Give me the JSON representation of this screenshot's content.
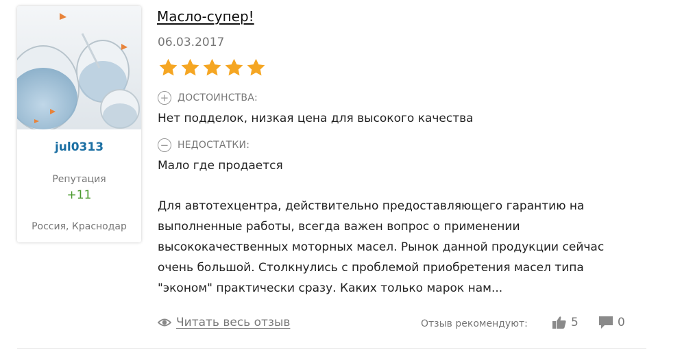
{
  "user": {
    "username": "jul0313",
    "reputation_label": "Репутация",
    "reputation_value": "+11",
    "location": "Россия, Краснодар"
  },
  "review": {
    "title": "Масло-супер!",
    "date": "06.03.2017",
    "rating": 5,
    "rating_max": 5,
    "pros_label": "ДОСТОИНСТВА:",
    "pros_text": "Нет подделок, низкая цена для высокого качества",
    "cons_label": "НЕДОСТАТКИ:",
    "cons_text": "Мало где продается",
    "body_lines": [
      "Для автотехцентра, действительно предоставляющего гарантию на",
      "выполненные работы, всегда важен вопрос о применении",
      "высококачественных моторных масел. Рынок данной продукции сейчас",
      "очень большой. Столкнулись с проблемой приобретения масел типа",
      "\"эконом\" практически сразу. Каких только марок нам..."
    ]
  },
  "footer": {
    "read_more": "Читать весь отзыв",
    "recommend_label": "Отзыв рекомендуют:",
    "likes": "5",
    "comments": "0"
  },
  "colors": {
    "star": "#f5a623",
    "username": "#1b6fa3",
    "reputation": "#4a9a2e",
    "muted": "#777777"
  },
  "icons": {
    "pros": "plus-circle-icon",
    "cons": "minus-circle-icon",
    "read_more": "eye-icon",
    "likes": "thumbs-up-icon",
    "comments": "comment-icon"
  }
}
